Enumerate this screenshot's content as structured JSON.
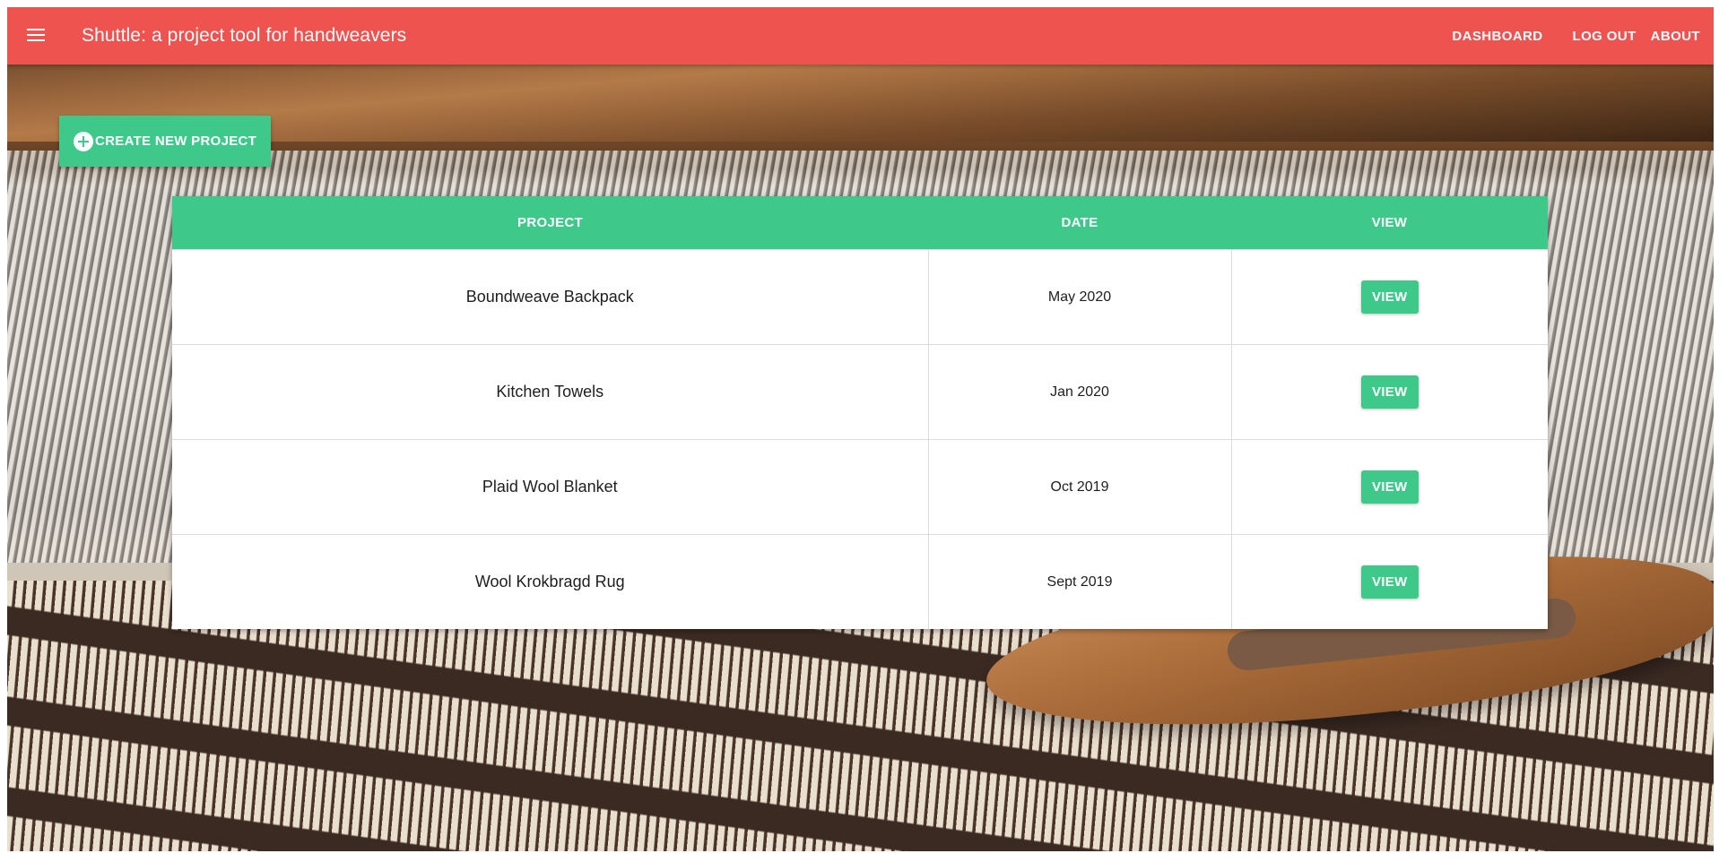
{
  "app": {
    "title": "Shuttle: a project tool for handweavers",
    "accent_color": "#ef5350",
    "primary_color": "#3ec98a"
  },
  "nav": {
    "menu_icon": "hamburger-menu-icon",
    "links": [
      {
        "label": "DASHBOARD"
      },
      {
        "label": "LOG OUT"
      },
      {
        "label": "ABOUT"
      }
    ]
  },
  "create_button": {
    "icon": "add-circle-icon",
    "label": "CREATE NEW PROJECT"
  },
  "table": {
    "headers": {
      "project": "PROJECT",
      "date": "DATE",
      "view": "VIEW"
    },
    "rows": [
      {
        "project": "Boundweave Backpack",
        "date": "May 2020",
        "action": "VIEW"
      },
      {
        "project": "Kitchen Towels",
        "date": "Jan 2020",
        "action": "VIEW"
      },
      {
        "project": "Plaid Wool Blanket",
        "date": "Oct 2019",
        "action": "VIEW"
      },
      {
        "project": "Wool Krokbragd Rug",
        "date": "Sept 2019",
        "action": "VIEW"
      }
    ]
  }
}
